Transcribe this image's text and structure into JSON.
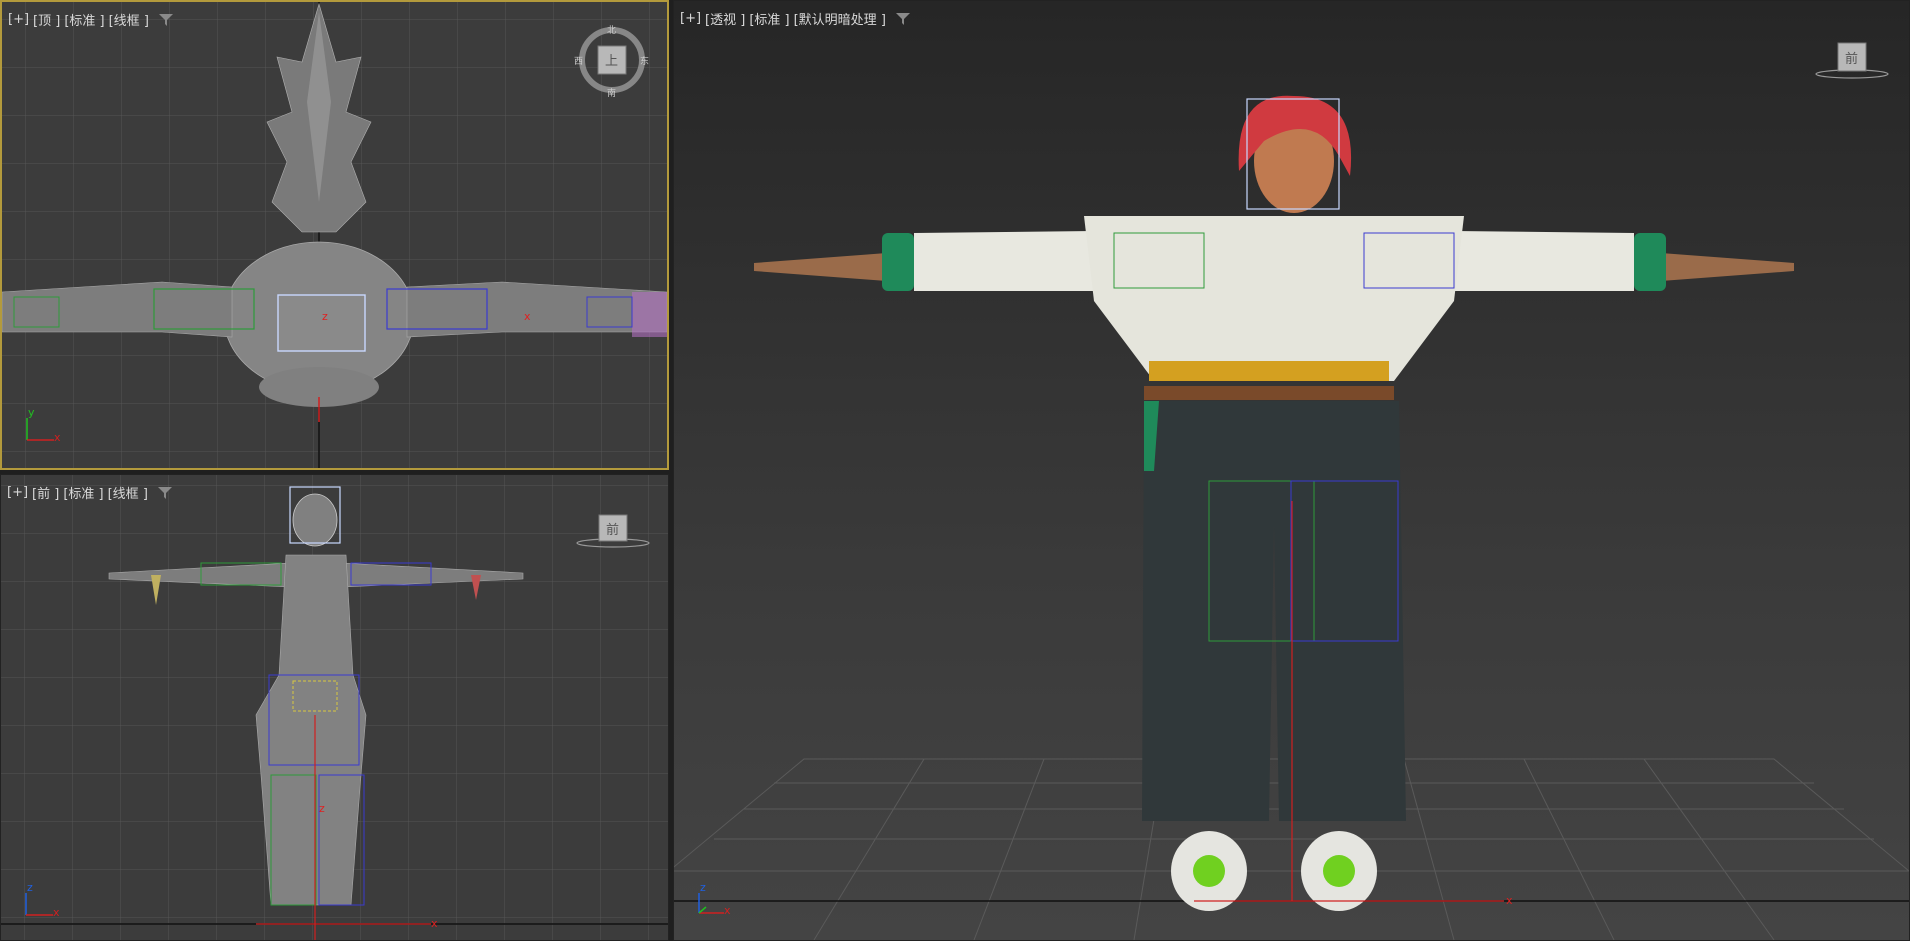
{
  "viewports": {
    "top": {
      "plus": "[+]",
      "view": "[顶 ]",
      "std": "[标准 ]",
      "shade": "[线框 ]",
      "cube_face": "上",
      "compass": {
        "n": "北",
        "s": "南",
        "e": "东",
        "w": "西"
      },
      "axis_x": "x",
      "axis_y": "y"
    },
    "front": {
      "plus": "[+]",
      "view": "[前 ]",
      "std": "[标准 ]",
      "shade": "[线框 ]",
      "cube_face": "前",
      "axis_x": "x",
      "axis_z": "z"
    },
    "perspective": {
      "plus": "[+]",
      "view": "[透视 ]",
      "std": "[标准 ]",
      "shade": "[默认明暗处理 ]",
      "cube_face": "前",
      "axis_x": "x",
      "axis_z": "z"
    }
  },
  "colors": {
    "active_border": "#b39a3c",
    "viewport_bg": "#3c3c3c",
    "grid": "#555555",
    "wire": "#9a9a9a",
    "bone_green": "#2e9a3a",
    "bone_blue": "#3a3ad0",
    "axis_x": "#d02020",
    "axis_y": "#20c020",
    "axis_z": "#2060e0"
  },
  "icons": {
    "filter": "filter-icon",
    "viewcube": "viewcube-icon",
    "axis_tripod": "axis-tripod-icon"
  }
}
